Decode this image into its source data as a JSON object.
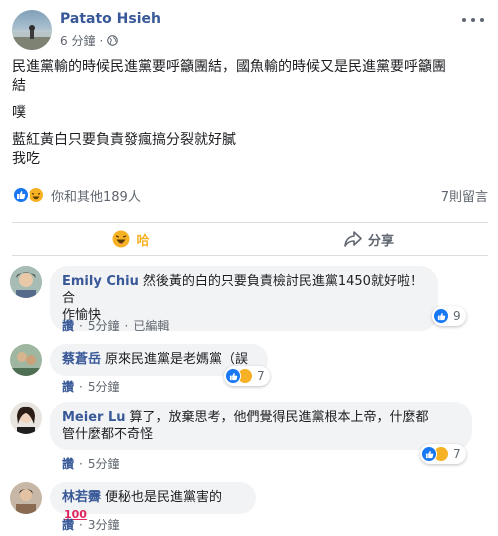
{
  "post": {
    "author": "Patato Hsieh",
    "time": "6 分鐘",
    "dot": "·",
    "lines": [
      "民進黨輸的時候民進黨要呼籲團結，國魚輸的時候又是民進黨要呼籲團",
      "結",
      "噗",
      "藍紅黃白只要負責發瘋搞分裂就好膩",
      "我吃"
    ],
    "reaction_summary": "你和其他189人",
    "comments_count": "7則留言"
  },
  "actions": {
    "haha_label": "哈",
    "share_label": "分享"
  },
  "comments": [
    {
      "name": "Emily Chiu",
      "text_line1": "然後黃的白的只要負責檢討民進黨1450就好啦！合",
      "text_line2": "作愉快",
      "reply": "讚",
      "time": "5分鐘",
      "edited": "已編輯",
      "reaction_count": "9"
    },
    {
      "name": "蔡蒼岳",
      "text_line1": "原來民進黨是老媽黨（誤",
      "reply": "讚",
      "time": "5分鐘",
      "reaction_count": "7"
    },
    {
      "name": "Meier Lu",
      "text_line1": "算了，放棄思考，他們覺得民進黨根本上帝，什麼都",
      "text_line2": "管什麼都不奇怪",
      "reply": "讚",
      "time": "5分鐘",
      "reaction_count": "7"
    },
    {
      "name": "林若霽",
      "text_line1": "便秘也是民進黨害的",
      "emoji_text": "100",
      "reply": "讚",
      "time": "3分鐘"
    }
  ],
  "colors": {
    "link_blue": "#385898",
    "like_blue": "#1877f2",
    "haha_yellow": "#f7b125",
    "bubble_bg": "#f2f3f5",
    "meta_gray": "#606770"
  },
  "icons": [
    "globe-icon",
    "more-icon",
    "like-icon",
    "haha-icon",
    "share-icon",
    "hundred-icon"
  ]
}
